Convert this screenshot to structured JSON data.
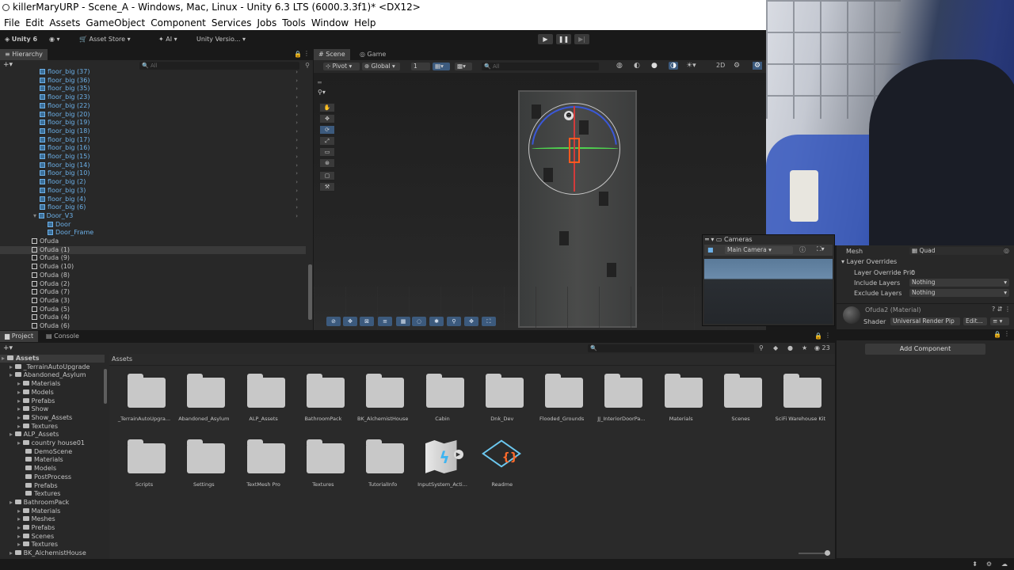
{
  "window": {
    "title": "killerMaryURP - Scene_A - Windows, Mac, Linux - Unity 6.3 LTS (6000.3.3f1)* <DX12>"
  },
  "menu": [
    "File",
    "Edit",
    "Assets",
    "GameObject",
    "Component",
    "Services",
    "Jobs",
    "Tools",
    "Window",
    "Help"
  ],
  "toolbar": {
    "unity_label": "Unity 6",
    "asset_store": "Asset Store",
    "ai": "AI",
    "unity_version": "Unity Versio...",
    "play": "▶",
    "pause": "❚❚",
    "step": "▶|"
  },
  "hierarchy": {
    "tab": "Hierarchy",
    "search_placeholder": "All",
    "items": [
      "floor_big (37)",
      "floor_big (36)",
      "floor_big (35)",
      "floor_big (23)",
      "floor_big (22)",
      "floor_big (20)",
      "floor_big (19)",
      "floor_big (18)",
      "floor_big (17)",
      "floor_big (16)",
      "floor_big (15)",
      "floor_big (14)",
      "floor_big (10)",
      "floor_big (2)",
      "floor_big (3)",
      "floor_big (4)",
      "floor_big (6)"
    ],
    "door_parent": "Door_V3",
    "door_children": [
      "Door",
      "Door_Frame"
    ],
    "ofuda": [
      "Ofuda",
      "Ofuda (1)",
      "Ofuda (9)",
      "Ofuda (10)",
      "Ofuda (8)",
      "Ofuda (2)",
      "Ofuda (7)",
      "Ofuda (3)",
      "Ofuda (5)",
      "Ofuda (4)",
      "Ofuda (6)"
    ]
  },
  "scene": {
    "tabs": [
      "Scene",
      "Game"
    ],
    "pivot": "Pivot",
    "global": "Global",
    "snap_value": "1",
    "search_placeholder": "All"
  },
  "camera_overlay": {
    "title": "Cameras",
    "selected": "Main Camera"
  },
  "inspector": {
    "mesh_label": "Mesh",
    "mesh_value": "Quad",
    "layer_overrides": "Layer Overrides",
    "layer_override_priority_label": "Layer Override Pric",
    "layer_override_priority_value": "0",
    "include_layers_label": "Include Layers",
    "include_layers_value": "Nothing",
    "exclude_layers_label": "Exclude Layers",
    "exclude_layers_value": "Nothing",
    "material_name": "Ofuda2 (Material)",
    "shader_label": "Shader",
    "shader_value": "Universal Render Pip",
    "edit_button": "Edit...",
    "add_component": "Add Component"
  },
  "project": {
    "tabs": [
      "Project",
      "Console"
    ],
    "breadcrumb": "Assets",
    "count": "23",
    "tree": [
      {
        "label": "Assets",
        "indent": 0,
        "bold": true
      },
      {
        "label": "_TerrainAutoUpgrade",
        "indent": 1
      },
      {
        "label": "Abandoned_Asylum",
        "indent": 1
      },
      {
        "label": "Materials",
        "indent": 2
      },
      {
        "label": "Models",
        "indent": 2
      },
      {
        "label": "Prefabs",
        "indent": 2
      },
      {
        "label": "Show",
        "indent": 2
      },
      {
        "label": "Show_Assets",
        "indent": 2
      },
      {
        "label": "Textures",
        "indent": 2
      },
      {
        "label": "ALP_Assets",
        "indent": 1
      },
      {
        "label": "country house01",
        "indent": 2
      },
      {
        "label": "DemoScene",
        "indent": 3
      },
      {
        "label": "Materials",
        "indent": 3
      },
      {
        "label": "Models",
        "indent": 3
      },
      {
        "label": "PostProcess",
        "indent": 3
      },
      {
        "label": "Prefabs",
        "indent": 3
      },
      {
        "label": "Textures",
        "indent": 3
      },
      {
        "label": "BathroomPack",
        "indent": 1
      },
      {
        "label": "Materials",
        "indent": 2
      },
      {
        "label": "Meshes",
        "indent": 2
      },
      {
        "label": "Prefabs",
        "indent": 2
      },
      {
        "label": "Scenes",
        "indent": 2
      },
      {
        "label": "Textures",
        "indent": 2
      },
      {
        "label": "BK_AlchemistHouse",
        "indent": 1
      }
    ],
    "assets": [
      "_TerrainAutoUpgra...",
      "Abandoned_Asylum",
      "ALP_Assets",
      "BathroomPack",
      "BK_AlchemistHouse",
      "Cabin",
      "Dnk_Dev",
      "Flooded_Grounds",
      "JJ_InteriorDoorPa...",
      "Materials",
      "Scenes",
      "SciFi Warehouse Kit",
      "Scripts",
      "Settings",
      "TextMesh Pro",
      "Textures",
      "TutorialInfo"
    ],
    "special_assets": [
      "InputSystem_Acti...",
      "Readme"
    ]
  },
  "colors": {
    "accent": "#3c6f99",
    "selected_blue": "#6cb0e8",
    "gizmo_orange": "#ff5a1f",
    "gizmo_green": "#4fd24f"
  }
}
